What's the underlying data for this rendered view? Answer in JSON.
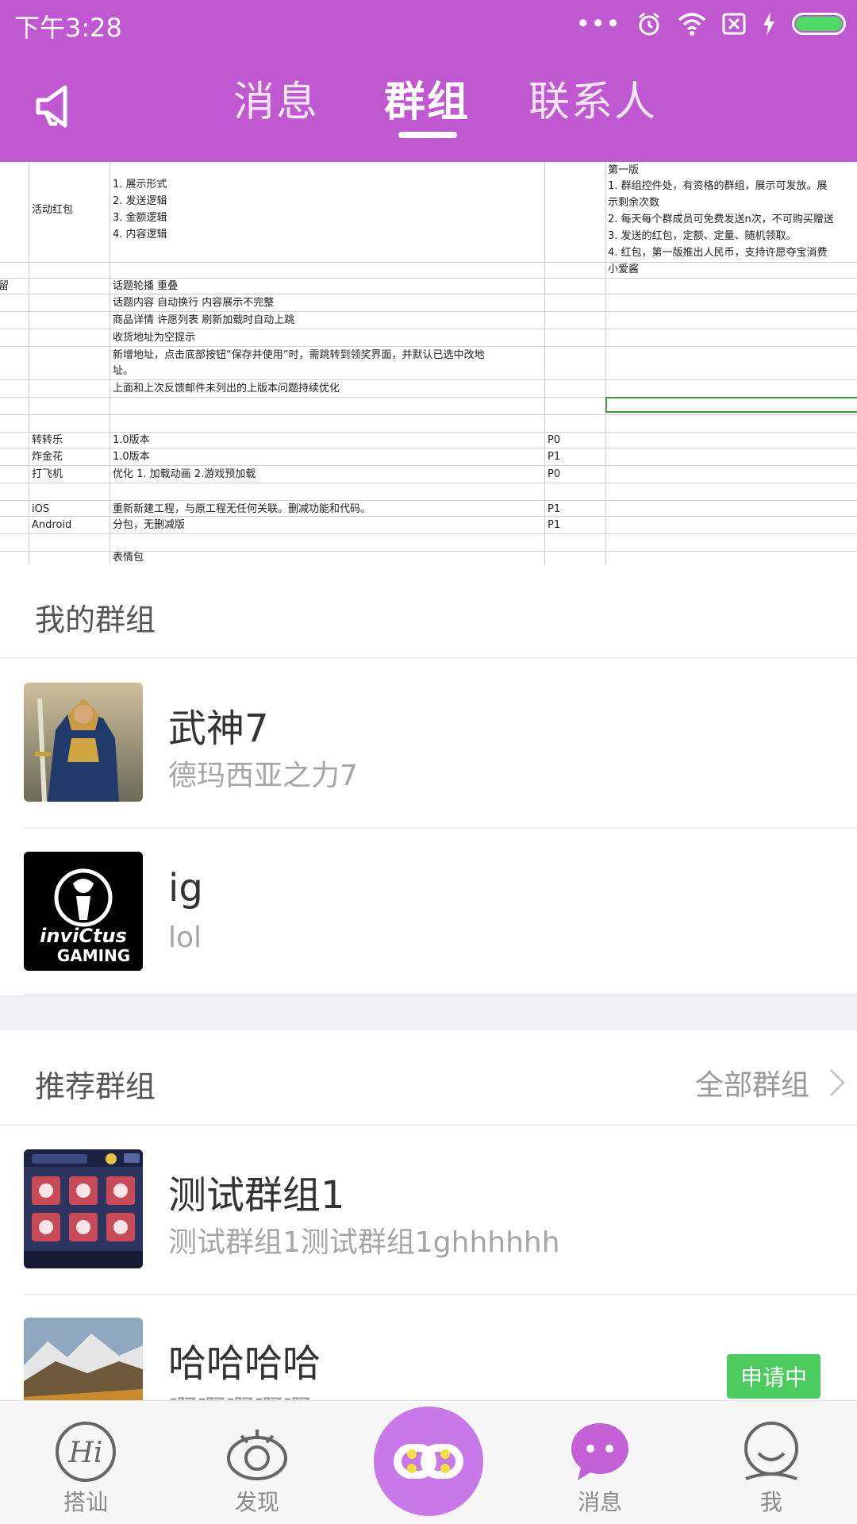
{
  "colors": {
    "brand": "#c059d1",
    "badge": "#4ccc5f",
    "chat_icon": "#c360d6"
  },
  "status_bar": {
    "time": "下午3:28",
    "icons": [
      "more-dots-icon",
      "alarm-icon",
      "wifi-icon",
      "no-sim-icon",
      "charging-icon",
      "battery-icon"
    ]
  },
  "header": {
    "tabs": [
      {
        "label": "消息",
        "active": false
      },
      {
        "label": "群组",
        "active": true
      },
      {
        "label": "联系人",
        "active": false
      }
    ]
  },
  "sheet": {
    "rows": [
      {
        "c1": "活动红包",
        "c2": [
          "1. 展示形式",
          "2. 发送逻辑",
          "3. 金额逻辑",
          "4. 内容逻辑"
        ],
        "c4": [
          "第一版",
          "1. 群组控件处，有资格的群组，展示可发放。展",
          "示剩余次数",
          "2. 每天每个群成员可免费发送n次，不可购买赠送",
          "3. 发送的红包，定额、定量、随机领取。",
          "4. 红包，第一版推出人民币，支持许愿夺宝消费",
          "小爱酱"
        ]
      },
      {
        "c0": "留",
        "c2": "话题轮播 重叠"
      },
      {
        "c2": "话题内容 自动换行 内容展示不完整"
      },
      {
        "c2": "商品详情  许愿列表 刷新加载时自动上跳"
      },
      {
        "c2": "收货地址为空提示"
      },
      {
        "c2": "新增地址，点击底部按钮“保存并使用”时，需跳转到领奖界面，并默认已选中改地"
      },
      {
        "c2": "址。"
      },
      {
        "c2": "上面和上次反馈邮件未列出的上版本问题持续优化"
      },
      {
        "c1": "转转乐",
        "c2": "1.0版本",
        "c3": "P0"
      },
      {
        "c1": "炸金花",
        "c2": "1.0版本",
        "c3": "P1"
      },
      {
        "c1": "打飞机",
        "c2": "优化 1. 加载动画  2.游戏预加载",
        "c3": "P0"
      },
      {
        "c1": "iOS",
        "c2": "重新新建工程，与原工程无任何关联。删减功能和代码。",
        "c3": "P1"
      },
      {
        "c1": "Android",
        "c2": "分包，无删减版",
        "c3": "P1"
      },
      {
        "c2": "表情包"
      }
    ]
  },
  "my_groups": {
    "title": "我的群组",
    "items": [
      {
        "name": "武神7",
        "desc": "德玛西亚之力7",
        "avatar": "hero-avatar"
      },
      {
        "name": "ig",
        "desc": "lol",
        "avatar": "invictus-gaming-logo"
      }
    ]
  },
  "recommended": {
    "title": "推荐群组",
    "see_all": "全部群组",
    "items": [
      {
        "name": "测试群组1",
        "desc": "测试群组1测试群组1ghhhhhh",
        "avatar": "game-screenshot-avatar"
      },
      {
        "name": "哈哈哈哈",
        "desc": "啊啊啊啊啊",
        "avatar": "mountain-avatar",
        "badge": "申请中"
      }
    ]
  },
  "bottom_nav": [
    {
      "label": "搭讪",
      "icon": "hi-icon"
    },
    {
      "label": "发现",
      "icon": "eye-icon"
    },
    {
      "label": "",
      "icon": "link-center-icon"
    },
    {
      "label": "消息",
      "icon": "chat-bubble-icon"
    },
    {
      "label": "我",
      "icon": "profile-icon"
    }
  ]
}
